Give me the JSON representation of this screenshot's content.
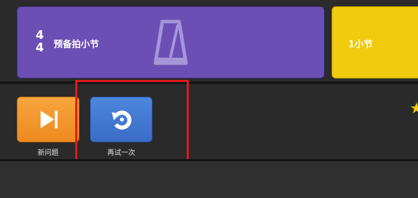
{
  "top_bar": {
    "count_in_card": {
      "time_signature_top": "4",
      "time_signature_bottom": "4",
      "label": "预备拍小节",
      "icon": "metronome-icon",
      "color": "#6b4fb4"
    },
    "measure_card": {
      "label": "1小节",
      "color": "#f0cb0e"
    }
  },
  "actions": {
    "new_question": {
      "label": "新问题",
      "icon": "skip-next-icon",
      "color": "#f39a2e"
    },
    "retry": {
      "label": "再试一次",
      "icon": "retry-icon",
      "color": "#4378d3",
      "highlighted": true
    }
  },
  "decorations": {
    "edge_icon": "star-icon",
    "highlight_color": "#e01b1b"
  }
}
